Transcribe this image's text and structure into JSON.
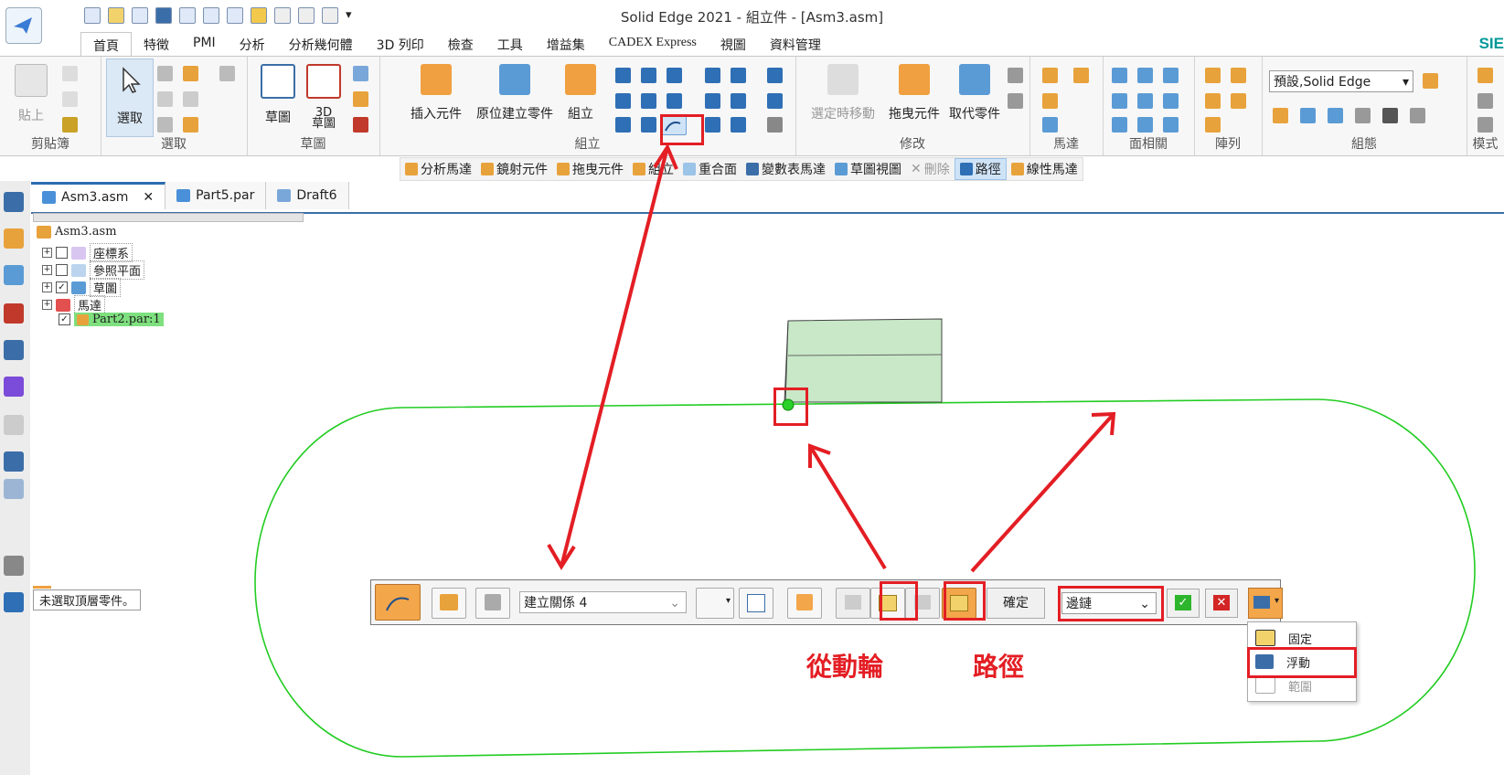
{
  "window": {
    "title": "Solid Edge 2021 - 組立件 - [Asm3.asm]",
    "brand": "SIE"
  },
  "ribbon_tabs": [
    "首頁",
    "特徵",
    "PMI",
    "分析",
    "分析幾何體",
    "3D 列印",
    "檢查",
    "工具",
    "增益集",
    "CADEX Express",
    "視圖",
    "資料管理"
  ],
  "ribbon": {
    "clipboard": {
      "label": "剪貼簿",
      "paste": "貼上"
    },
    "select": {
      "label": "選取",
      "select": "選取"
    },
    "sketch": {
      "label": "草圖",
      "sketch": "草圖",
      "sketch3d": "3D\n草圖"
    },
    "assemble": {
      "label": "組立",
      "insert": "插入元件",
      "inplace": "原位建立零件",
      "assemble": "組立"
    },
    "modify": {
      "label": "修改",
      "move": "選定時移動",
      "drag": "拖曳元件",
      "replace": "取代零件"
    },
    "motor": {
      "label": "馬達"
    },
    "face": {
      "label": "面相關"
    },
    "pattern": {
      "label": "陣列"
    },
    "config": {
      "label": "組態",
      "combo": "預設,Solid Edge"
    },
    "mode": {
      "label": "模式"
    }
  },
  "ctx_toolbar": [
    {
      "label": "分析馬達",
      "disabled": false,
      "selected": false
    },
    {
      "label": "鏡射元件",
      "disabled": false,
      "selected": false
    },
    {
      "label": "拖曳元件",
      "disabled": false,
      "selected": false
    },
    {
      "label": "組立",
      "disabled": false,
      "selected": false
    },
    {
      "label": "重合面",
      "disabled": false,
      "selected": false
    },
    {
      "label": "變數表馬達",
      "disabled": false,
      "selected": false
    },
    {
      "label": "草圖視圖",
      "disabled": false,
      "selected": false
    },
    {
      "label": "刪除",
      "disabled": true,
      "selected": false
    },
    {
      "label": "路徑",
      "disabled": false,
      "selected": true
    },
    {
      "label": "線性馬達",
      "disabled": false,
      "selected": false
    }
  ],
  "doc_tabs": [
    {
      "label": "Asm3.asm",
      "active": true
    },
    {
      "label": "Part5.par",
      "active": false
    },
    {
      "label": "Draft6",
      "active": false
    }
  ],
  "tree": {
    "root": "Asm3.asm",
    "items": [
      {
        "label": "座標系",
        "checked": false
      },
      {
        "label": "參照平面",
        "checked": false
      },
      {
        "label": "草圖",
        "checked": true
      },
      {
        "label": "馬達",
        "checked": null
      },
      {
        "label": "Part2.par:1",
        "checked": true
      }
    ]
  },
  "status_note": "未選取頂層零件。",
  "command_bar": {
    "relation": "建立關係 4",
    "ok": "確定",
    "edge_mode": "邊鏈"
  },
  "dropdown": {
    "items": [
      {
        "label": "固定",
        "disabled": false
      },
      {
        "label": "浮動",
        "disabled": false
      },
      {
        "label": "範圍",
        "disabled": true
      }
    ]
  },
  "annotations": {
    "follower": "從動輪",
    "path": "路徑"
  },
  "colors": {
    "highlight": "#e31e24",
    "path_curve": "#22cc22",
    "part_fill": "#c8e8c8",
    "accent": "#f3a64a"
  }
}
